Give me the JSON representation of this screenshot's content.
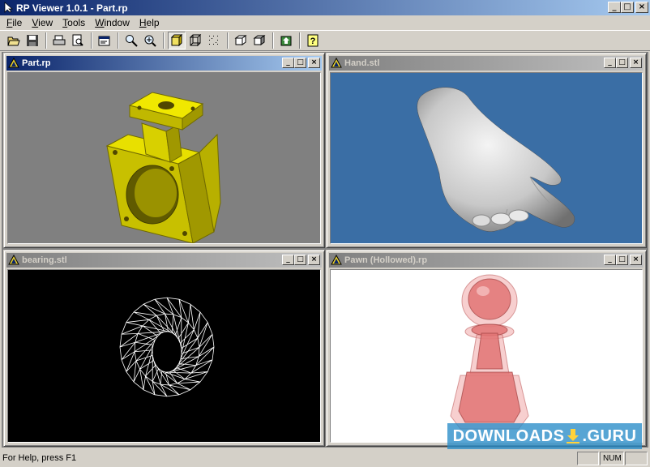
{
  "app": {
    "title": "RP Viewer 1.0.1 - Part.rp",
    "window_buttons": [
      "_",
      "□",
      "×"
    ]
  },
  "menu": [
    {
      "label": "File",
      "accel": "F",
      "rest": "ile"
    },
    {
      "label": "View",
      "accel": "V",
      "rest": "iew"
    },
    {
      "label": "Tools",
      "accel": "T",
      "rest": "ools"
    },
    {
      "label": "Window",
      "accel": "W",
      "rest": "indow"
    },
    {
      "label": "Help",
      "accel": "H",
      "rest": "elp"
    }
  ],
  "toolbar": {
    "buttons": [
      "open-icon",
      "save-icon",
      "print-icon",
      "print-preview-icon",
      "properties-icon",
      "zoom-icon",
      "zoom-in-icon",
      "solid-view-icon",
      "wireframe-view-icon",
      "points-view-icon",
      "box-icon",
      "box-shaded-icon",
      "export-icon",
      "help-icon"
    ],
    "pressed": "solid-view-icon"
  },
  "windows": [
    {
      "title": "Part.rp",
      "active": true,
      "bg": "#808080"
    },
    {
      "title": "Hand.stl",
      "active": false,
      "bg": "#3a6ea5"
    },
    {
      "title": "bearing.stl",
      "active": false,
      "bg": "#000000"
    },
    {
      "title": "Pawn (Hollowed).rp",
      "active": false,
      "bg": "#ffffff"
    }
  ],
  "status": {
    "help_text": "For Help, press F1",
    "num": "NUM"
  },
  "watermark": {
    "text_left": "DOWNLOADS",
    "text_right": ".GURU"
  },
  "colors": {
    "titlebar_start": "#0a246a",
    "titlebar_end": "#a6caf0",
    "face": "#d4d0c8",
    "part_yellow": "#e8e000",
    "pawn_red": "#e88080"
  }
}
